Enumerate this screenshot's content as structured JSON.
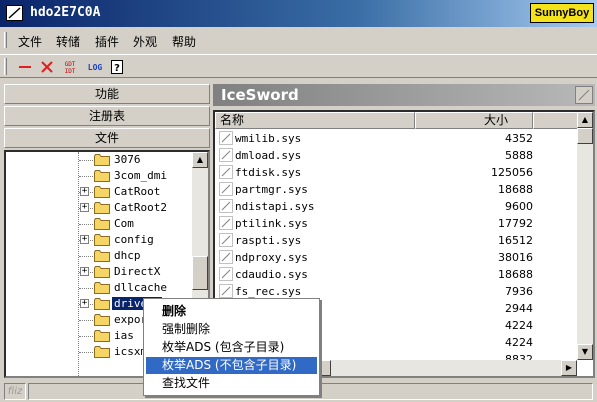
{
  "window": {
    "title": "hdo2E7C0A",
    "brand": "SunnyBoy"
  },
  "menu": [
    "文件",
    "转储",
    "插件",
    "外观",
    "帮助"
  ],
  "toolbar": {
    "gdt_idt": "GDT\nIDT",
    "log": "LOG",
    "help": "?"
  },
  "left": {
    "tabs": [
      "功能",
      "注册表",
      "文件"
    ],
    "tree": [
      {
        "label": "3076",
        "expandable": false
      },
      {
        "label": "3com_dmi",
        "expandable": false
      },
      {
        "label": "CatRoot",
        "expandable": true
      },
      {
        "label": "CatRoot2",
        "expandable": true
      },
      {
        "label": "Com",
        "expandable": false
      },
      {
        "label": "config",
        "expandable": true
      },
      {
        "label": "dhcp",
        "expandable": false
      },
      {
        "label": "DirectX",
        "expandable": true
      },
      {
        "label": "dllcache",
        "expandable": false
      },
      {
        "label": "drivers",
        "expandable": true,
        "selected": true
      },
      {
        "label": "export",
        "expandable": false
      },
      {
        "label": "ias",
        "expandable": false
      },
      {
        "label": "icsxml",
        "expandable": false
      }
    ]
  },
  "right": {
    "title": "IceSword",
    "columns": [
      "名称",
      "大小"
    ],
    "files": [
      {
        "name": "wmilib.sys",
        "size": "4352"
      },
      {
        "name": "dmload.sys",
        "size": "5888"
      },
      {
        "name": "ftdisk.sys",
        "size": "125056"
      },
      {
        "name": "partmgr.sys",
        "size": "18688"
      },
      {
        "name": "ndistapi.sys",
        "size": "9600"
      },
      {
        "name": "ptilink.sys",
        "size": "17792"
      },
      {
        "name": "raspti.sys",
        "size": "16512"
      },
      {
        "name": "ndproxy.sys",
        "size": "38016"
      },
      {
        "name": "cdaudio.sys",
        "size": "18688"
      },
      {
        "name": "fs_rec.sys",
        "size": "7936"
      },
      {
        "name": "",
        "size": "2944"
      },
      {
        "name": "",
        "size": "4224"
      },
      {
        "name": "",
        "size": "4224"
      },
      {
        "name": "",
        "size": "8832"
      }
    ]
  },
  "context_menu": [
    {
      "label": "删除",
      "bold": true
    },
    {
      "label": "强制删除",
      "bold": false
    },
    {
      "label": "枚举ADS (包含子目录)",
      "bold": false
    },
    {
      "label": "枚举ADS (不包含子目录)",
      "bold": false,
      "highlighted": true
    },
    {
      "label": "查找文件",
      "bold": false
    }
  ],
  "status": {
    "left_text": "fiiz"
  }
}
